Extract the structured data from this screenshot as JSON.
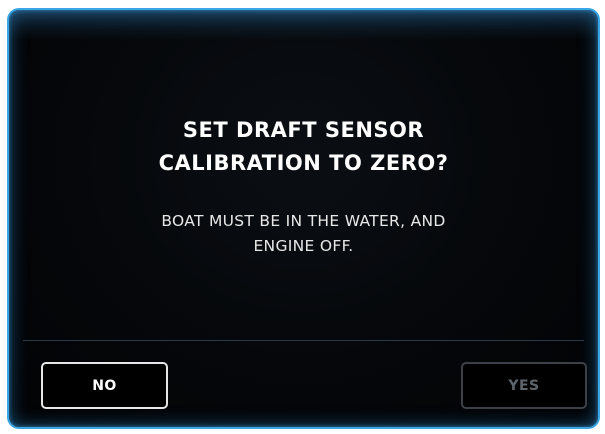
{
  "dialog": {
    "title_lines": [
      "SET DRAFT SENSOR",
      "CALIBRATION TO ZERO?"
    ],
    "message_lines": [
      "BOAT MUST BE IN THE WATER, AND",
      "ENGINE OFF."
    ],
    "buttons": {
      "no_label": "NO",
      "yes_label": "YES",
      "yes_enabled": false
    }
  },
  "colors": {
    "border_accent": "#3aa6e6",
    "background": "#05070a",
    "text_primary": "#ffffff",
    "text_disabled": "#5e656b"
  }
}
